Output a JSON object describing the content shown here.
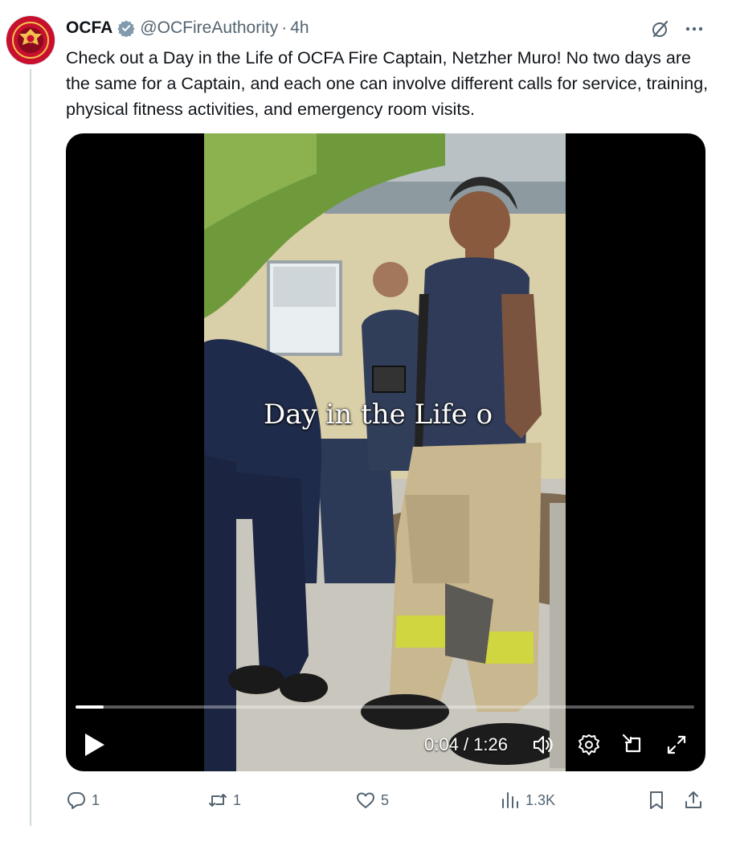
{
  "account": {
    "name": "OCFA",
    "handle": "@OCFireAuthority",
    "separator": "·",
    "time": "4h",
    "avatar_icon": "ocfa-fire-badge-logo",
    "verified_icon": "verified-badge-icon"
  },
  "tweet": {
    "text": "Check out a Day in the Life of OCFA Fire Captain, Netzher Muro! No two days are the same for a Captain, and each one can involve different calls for service, training, physical fitness activities, and emergency room visits."
  },
  "video": {
    "caption_overlay": "Day in the Life o",
    "time_current": "0:04",
    "time_total": "1:26",
    "time_separator": " / ",
    "progress_fraction": 0.045,
    "controls": [
      "play-icon",
      "volume-icon",
      "settings-gear-icon",
      "pip-icon",
      "fullscreen-expand-icon"
    ]
  },
  "actions": {
    "replies": "1",
    "reposts": "1",
    "likes": "5",
    "views": "1.3K"
  },
  "colors": {
    "brand_red": "#c8102e",
    "verified_gray": "#829aab",
    "secondary_text": "#536471",
    "thread_line": "#cfd9de"
  }
}
